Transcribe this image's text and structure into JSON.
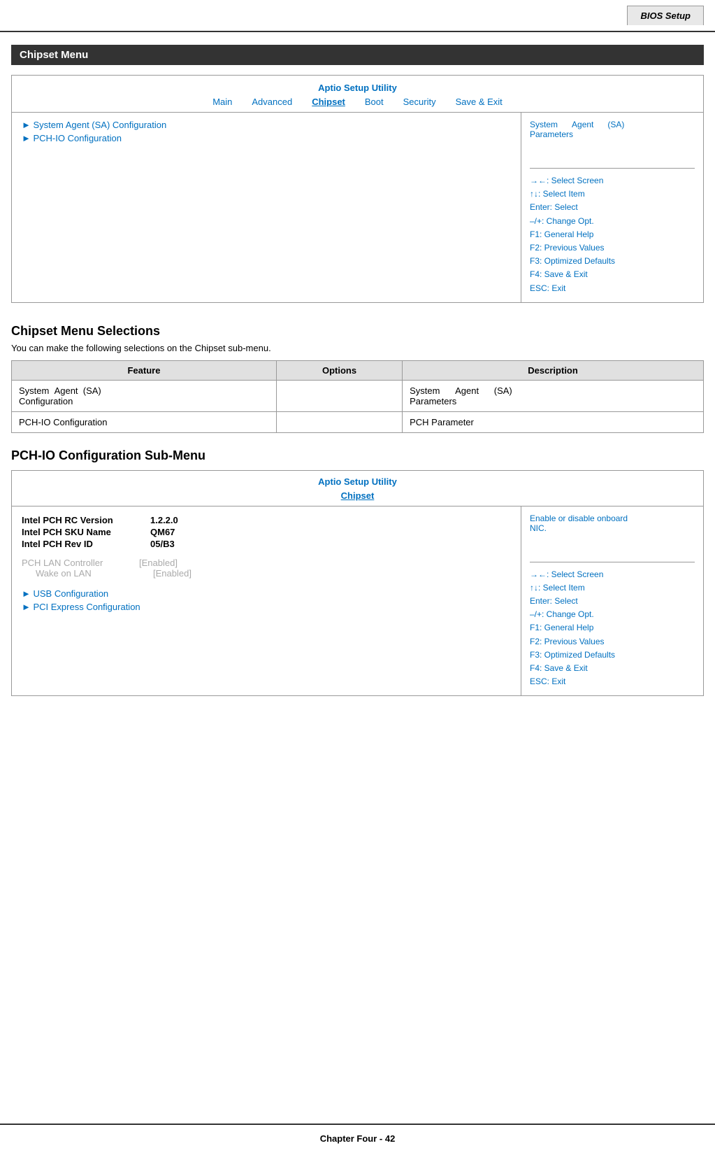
{
  "header": {
    "tab_label": "BIOS Setup"
  },
  "section_title": "Chipset Menu",
  "bios_panel": {
    "utility_title": "Aptio Setup Utility",
    "nav_items": [
      {
        "label": "Main",
        "active": false
      },
      {
        "label": "Advanced",
        "active": false
      },
      {
        "label": "Chipset",
        "active": true
      },
      {
        "label": "Boot",
        "active": false
      },
      {
        "label": "Security",
        "active": false
      },
      {
        "label": "Save & Exit",
        "active": false
      }
    ],
    "left_items": [
      "► System Agent (SA) Configuration",
      "► PCH-IO Configuration"
    ],
    "right_desc": "System      Agent      (SA)\nParameters",
    "help_items": [
      "→←: Select Screen",
      "↑↓: Select Item",
      "Enter: Select",
      "–/+: Change Opt.",
      "F1: General Help",
      "F2: Previous Values",
      "F3: Optimized Defaults",
      "F4: Save & Exit",
      "ESC: Exit"
    ]
  },
  "selections_heading": "Chipset Menu Selections",
  "selections_para": "You can make the following selections on the Chipset sub-menu.",
  "selections_table": {
    "headers": [
      "Feature",
      "Options",
      "Description"
    ],
    "rows": [
      {
        "feature": "System   Agent   (SA)\nConfiguration",
        "options": "",
        "description": "System        Agent        (SA)\nParameters"
      },
      {
        "feature": "PCH-IO Configuration",
        "options": "",
        "description": "PCH Parameter"
      }
    ]
  },
  "pch_sub_heading": "PCH-IO Configuration Sub-Menu",
  "pch_panel": {
    "utility_title": "Aptio Setup Utility",
    "chipset_label": "Chipset",
    "info_rows": [
      {
        "label": "Intel PCH RC Version",
        "value": "1.2.2.0"
      },
      {
        "label": "Intel PCH SKU Name",
        "value": "QM67"
      },
      {
        "label": "Intel PCH Rev ID",
        "value": "05/B3"
      }
    ],
    "lan_label": "PCH LAN Controller",
    "lan_value": "[Enabled]",
    "wake_label": "Wake on LAN",
    "wake_value": "[Enabled]",
    "links": [
      "► USB Configuration",
      "► PCI Express Configuration"
    ],
    "right_desc": "Enable or disable onboard\nNIC.",
    "help_items": [
      "→←: Select Screen",
      "↑↓: Select Item",
      "Enter: Select",
      "–/+: Change Opt.",
      "F1: General Help",
      "F2: Previous Values",
      "F3: Optimized Defaults",
      "F4: Save & Exit",
      "ESC: Exit"
    ]
  },
  "footer": "Chapter Four - 42"
}
